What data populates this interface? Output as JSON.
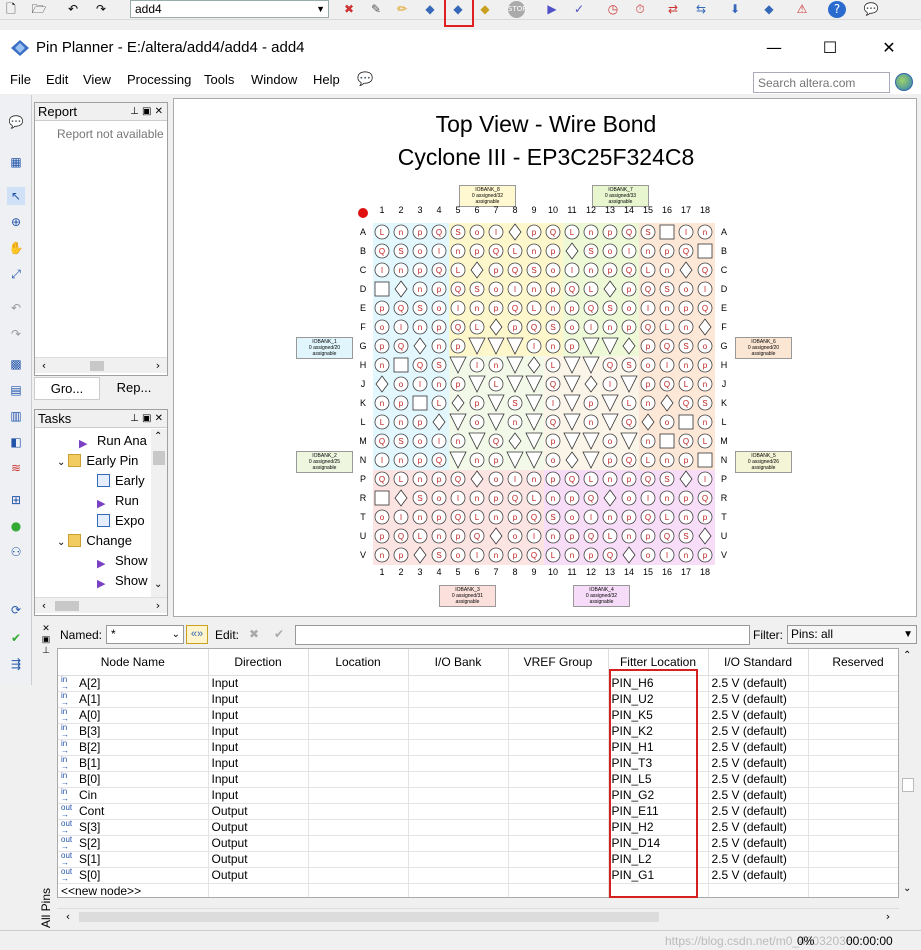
{
  "toolbar": {
    "project": "add4",
    "icons": [
      "new-icon",
      "open-icon",
      "undo-icon",
      "redo-icon",
      "pin-planner-icon",
      "assignment-icon",
      "chip-planner-icon",
      "compile-icon",
      "analysis-icon",
      "stop-icon",
      "start-icon",
      "timing-icon",
      "clock-icon",
      "rtl-viewer-icon",
      "netlist-icon",
      "programmer-icon",
      "signal-icon",
      "help-icon",
      "chat-icon"
    ]
  },
  "window": {
    "title": "Pin Planner - E:/altera/add4/add4 - add4",
    "minimize": "—",
    "maximize": "☐",
    "close": "✕"
  },
  "menubar": {
    "items": [
      "File",
      "Edit",
      "View",
      "Processing",
      "Tools",
      "Window",
      "Help"
    ],
    "search_placeholder": "Search altera.com"
  },
  "report_panel": {
    "title": "Report",
    "message": "Report not available",
    "tabs": [
      "Gro...",
      "Rep..."
    ]
  },
  "tasks_panel": {
    "title": "Tasks",
    "items": [
      {
        "label": "Run Ana",
        "icon": "play-icon"
      },
      {
        "label": "Early Pin",
        "icon": "folder-icon"
      },
      {
        "label": "Early",
        "icon": "window-icon"
      },
      {
        "label": "Run",
        "icon": "play-icon"
      },
      {
        "label": "Expo",
        "icon": "window-icon"
      },
      {
        "label": "Change",
        "icon": "folder-icon"
      },
      {
        "label": "Show",
        "icon": "play-icon"
      },
      {
        "label": "Show",
        "icon": "play-icon"
      }
    ]
  },
  "package_view": {
    "title": "Top View - Wire Bond",
    "subtitle": "Cyclone III - EP3C25F324C8",
    "columns": [
      "1",
      "2",
      "3",
      "4",
      "5",
      "6",
      "7",
      "8",
      "9",
      "10",
      "11",
      "12",
      "13",
      "14",
      "15",
      "16",
      "17",
      "18"
    ],
    "rows": [
      "A",
      "B",
      "C",
      "D",
      "E",
      "F",
      "G",
      "H",
      "J",
      "K",
      "L",
      "M",
      "N",
      "P",
      "R",
      "T",
      "U",
      "V"
    ],
    "banks": [
      {
        "name": "IOBANK_8",
        "info": "0 assigned/32 assignable"
      },
      {
        "name": "IOBANK_7",
        "info": "0 assigned/33 assignable"
      },
      {
        "name": "IOBANK_1",
        "info": "0 assigned/20 assignable"
      },
      {
        "name": "IOBANK_6",
        "info": "0 assigned/20 assignable"
      },
      {
        "name": "IOBANK_2",
        "info": "0 assigned/25 assignable"
      },
      {
        "name": "IOBANK_5",
        "info": "0 assigned/26 assignable"
      },
      {
        "name": "IOBANK_3",
        "info": "0 assigned/31 assignable"
      },
      {
        "name": "IOBANK_4",
        "info": "0 assigned/32 assignable"
      }
    ]
  },
  "filterbar": {
    "named_label": "Named:",
    "named_value": "*",
    "edit_label": "Edit:",
    "filter_label": "Filter:",
    "filter_value": "Pins: all"
  },
  "grid": {
    "columns": [
      "Node Name",
      "Direction",
      "Location",
      "I/O Bank",
      "VREF Group",
      "Fitter Location",
      "I/O Standard",
      "Reserved"
    ],
    "rows": [
      {
        "name": "A[2]",
        "dir": "Input",
        "kind": "in",
        "fitter": "PIN_H6",
        "std": "2.5 V (default)"
      },
      {
        "name": "A[1]",
        "dir": "Input",
        "kind": "in",
        "fitter": "PIN_U2",
        "std": "2.5 V (default)"
      },
      {
        "name": "A[0]",
        "dir": "Input",
        "kind": "in",
        "fitter": "PIN_K5",
        "std": "2.5 V (default)"
      },
      {
        "name": "B[3]",
        "dir": "Input",
        "kind": "in",
        "fitter": "PIN_K2",
        "std": "2.5 V (default)"
      },
      {
        "name": "B[2]",
        "dir": "Input",
        "kind": "in",
        "fitter": "PIN_H1",
        "std": "2.5 V (default)"
      },
      {
        "name": "B[1]",
        "dir": "Input",
        "kind": "in",
        "fitter": "PIN_T3",
        "std": "2.5 V (default)"
      },
      {
        "name": "B[0]",
        "dir": "Input",
        "kind": "in",
        "fitter": "PIN_L5",
        "std": "2.5 V (default)"
      },
      {
        "name": "Cin",
        "dir": "Input",
        "kind": "in",
        "fitter": "PIN_G2",
        "std": "2.5 V (default)"
      },
      {
        "name": "Cont",
        "dir": "Output",
        "kind": "out",
        "fitter": "PIN_E11",
        "std": "2.5 V (default)"
      },
      {
        "name": "S[3]",
        "dir": "Output",
        "kind": "out",
        "fitter": "PIN_H2",
        "std": "2.5 V (default)"
      },
      {
        "name": "S[2]",
        "dir": "Output",
        "kind": "out",
        "fitter": "PIN_D14",
        "std": "2.5 V (default)"
      },
      {
        "name": "S[1]",
        "dir": "Output",
        "kind": "out",
        "fitter": "PIN_L2",
        "std": "2.5 V (default)"
      },
      {
        "name": "S[0]",
        "dir": "Output",
        "kind": "out",
        "fitter": "PIN_G1",
        "std": "2.5 V (default)"
      }
    ],
    "new_node": "<<new node>>",
    "side_label": "All Pins"
  },
  "status": {
    "progress": "0%",
    "time": "00:00:00",
    "watermark": "https://blog.csdn.net/m0_46032036"
  }
}
